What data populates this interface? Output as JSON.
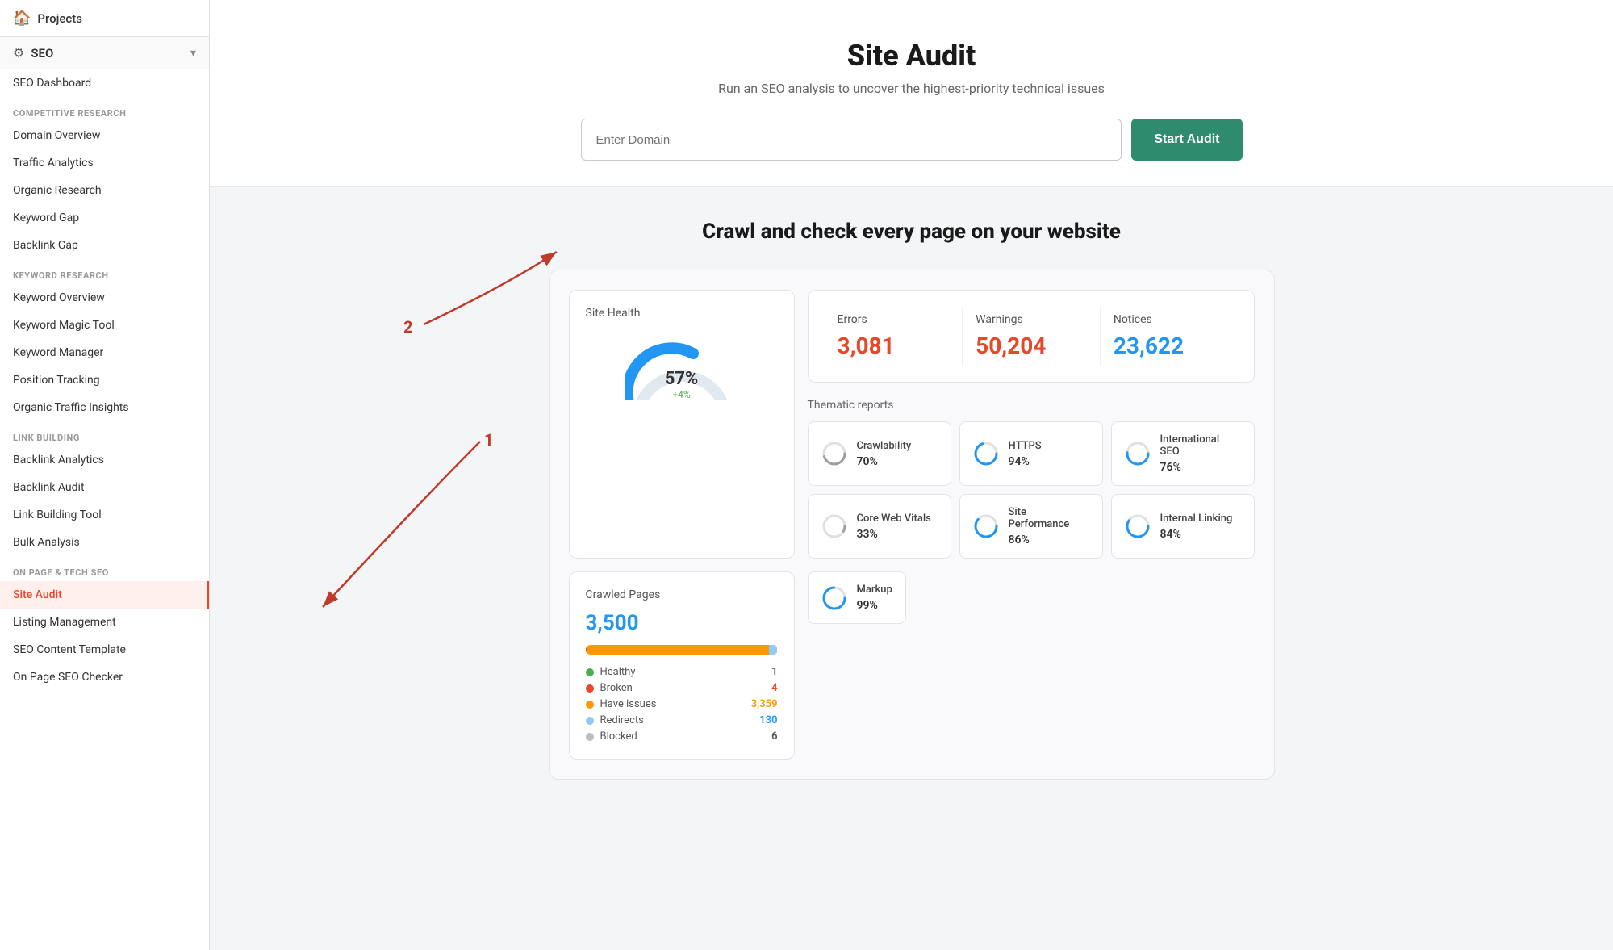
{
  "sidebar": {
    "projects_label": "Projects",
    "seo_label": "SEO",
    "seo_dashboard": "SEO Dashboard",
    "categories": [
      {
        "name": "COMPETITIVE RESEARCH",
        "items": [
          "Domain Overview",
          "Traffic Analytics",
          "Organic Research",
          "Keyword Gap",
          "Backlink Gap"
        ]
      },
      {
        "name": "KEYWORD RESEARCH",
        "items": [
          "Keyword Overview",
          "Keyword Magic Tool",
          "Keyword Manager",
          "Position Tracking",
          "Organic Traffic Insights"
        ]
      },
      {
        "name": "LINK BUILDING",
        "items": [
          "Backlink Analytics",
          "Backlink Audit",
          "Link Building Tool",
          "Bulk Analysis"
        ]
      },
      {
        "name": "ON PAGE & TECH SEO",
        "items": [
          "Site Audit",
          "Listing Management",
          "SEO Content Template",
          "On Page SEO Checker"
        ]
      }
    ],
    "active_item": "Site Audit"
  },
  "hero": {
    "title": "Site Audit",
    "subtitle": "Run an SEO analysis to uncover the highest-priority technical issues",
    "input_placeholder": "Enter Domain",
    "start_button": "Start Audit"
  },
  "main": {
    "crawl_title": "Crawl and check every page on your website",
    "site_health": {
      "label": "Site Health",
      "percent": "57%",
      "change": "+4%"
    },
    "stats": {
      "errors_label": "Errors",
      "errors_value": "3,081",
      "warnings_label": "Warnings",
      "warnings_value": "50,204",
      "notices_label": "Notices",
      "notices_value": "23,622"
    },
    "thematic": {
      "title": "Thematic reports",
      "items": [
        {
          "name": "Crawlability",
          "pct": "70%",
          "color": "#9e9e9e",
          "fill_pct": 70
        },
        {
          "name": "HTTPS",
          "pct": "94%",
          "color": "#2196f3",
          "fill_pct": 94
        },
        {
          "name": "International SEO",
          "pct": "76%",
          "color": "#2196f3",
          "fill_pct": 76
        },
        {
          "name": "Core Web Vitals",
          "pct": "33%",
          "color": "#9e9e9e",
          "fill_pct": 33
        },
        {
          "name": "Site Performance",
          "pct": "86%",
          "color": "#2196f3",
          "fill_pct": 86
        },
        {
          "name": "Internal Linking",
          "pct": "84%",
          "color": "#2196f3",
          "fill_pct": 84
        }
      ]
    },
    "markup": {
      "name": "Markup",
      "pct": "99%",
      "color": "#2196f3",
      "fill_pct": 99
    },
    "crawled_pages": {
      "label": "Crawled Pages",
      "number": "3,500",
      "legend": [
        {
          "label": "Healthy",
          "value": "1",
          "color": "#4caf50",
          "bar_pct": 0.03,
          "num_class": ""
        },
        {
          "label": "Broken",
          "value": "4",
          "color": "#e8472a",
          "bar_pct": 0.1,
          "num_class": "red"
        },
        {
          "label": "Have issues",
          "value": "3,359",
          "color": "#ff9800",
          "bar_pct": 96,
          "num_class": "orange"
        },
        {
          "label": "Redirects",
          "value": "130",
          "color": "#90caf9",
          "bar_pct": 3.7,
          "num_class": "blue"
        },
        {
          "label": "Blocked",
          "value": "6",
          "color": "#bdbdbd",
          "bar_pct": 0.17,
          "num_class": ""
        }
      ]
    }
  },
  "colors": {
    "accent_red": "#e8472a",
    "accent_blue": "#2196f3",
    "accent_green": "#2e8b6e",
    "sidebar_active_bg": "#fff0ee",
    "sidebar_active_text": "#e8472a"
  }
}
